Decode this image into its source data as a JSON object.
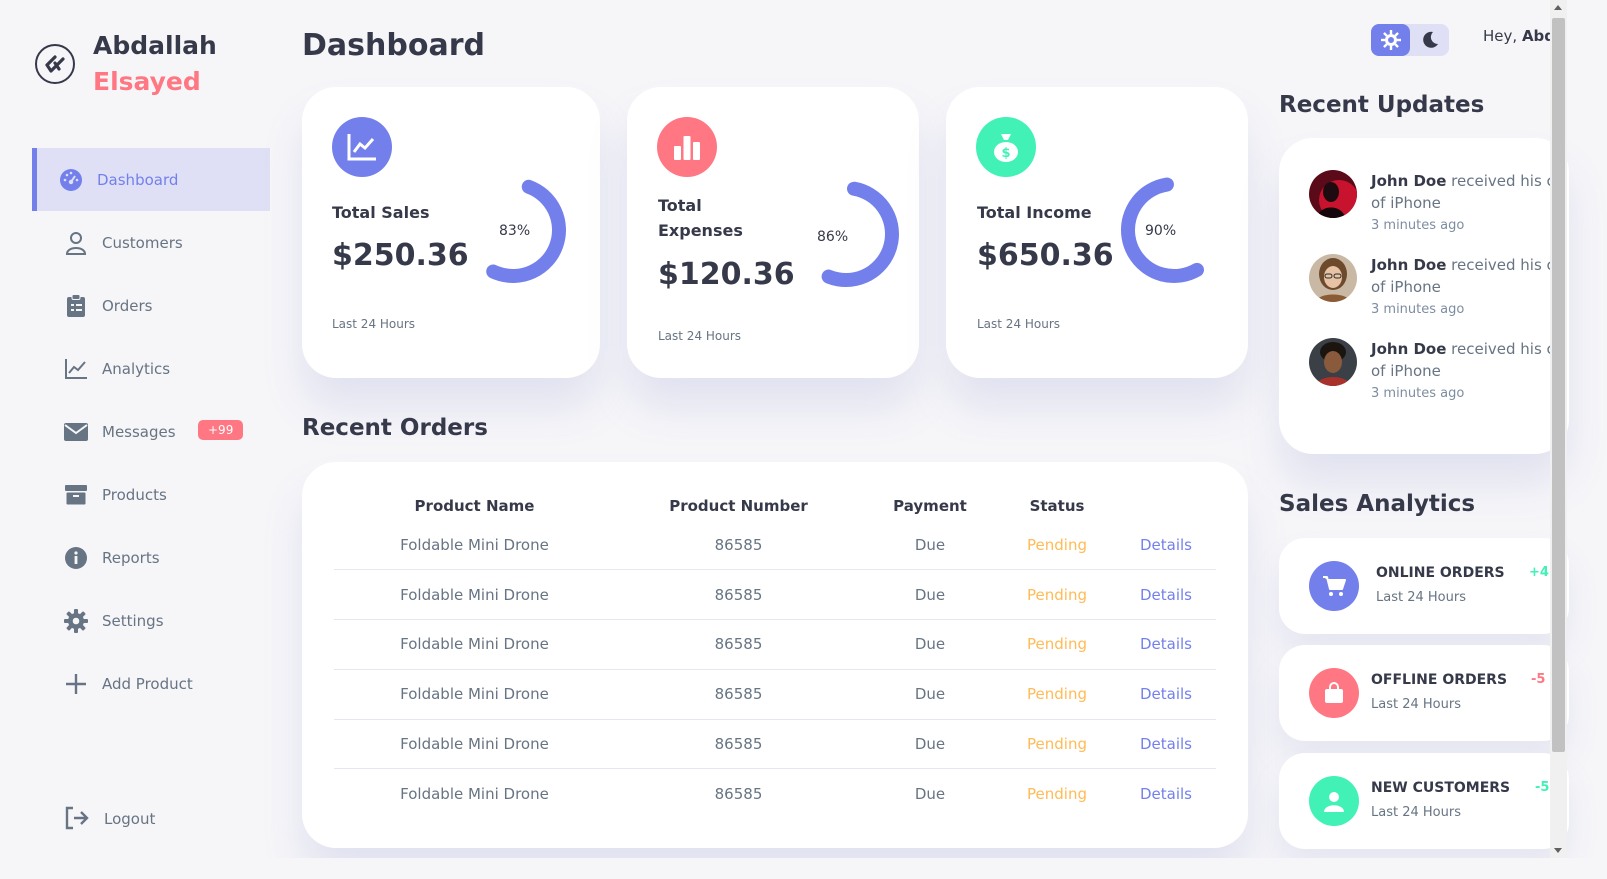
{
  "brand": {
    "first": "Abdallah",
    "last": "Elsayed"
  },
  "sidebar": {
    "items": [
      {
        "label": "Dashboard",
        "icon": "dashboard-icon",
        "active": true
      },
      {
        "label": "Customers",
        "icon": "person-icon"
      },
      {
        "label": "Orders",
        "icon": "clipboard-icon"
      },
      {
        "label": "Analytics",
        "icon": "chart-line-icon"
      },
      {
        "label": "Messages",
        "icon": "mail-icon",
        "badge": "+99"
      },
      {
        "label": "Products",
        "icon": "box-icon"
      },
      {
        "label": "Reports",
        "icon": "info-icon"
      },
      {
        "label": "Settings",
        "icon": "gear-icon"
      },
      {
        "label": "Add Product",
        "icon": "plus-icon"
      }
    ],
    "logout": "Logout"
  },
  "main": {
    "title": "Dashboard",
    "cards": [
      {
        "title": "Total Sales",
        "value": "$250.36",
        "percent": "83%",
        "percent_value": 83,
        "sub": "Last 24 Hours",
        "icon": "chart-line-icon",
        "color": "#7380ec"
      },
      {
        "title": "Total Expenses",
        "value": "$120.36",
        "percent": "86%",
        "percent_value": 86,
        "sub": "Last 24 Hours",
        "icon": "bar-chart-icon",
        "color": "#ff7782"
      },
      {
        "title": "Total Income",
        "value": "$650.36",
        "percent": "90%",
        "percent_value": 90,
        "sub": "Last 24 Hours",
        "icon": "money-bag-icon",
        "color": "#41f1b6"
      }
    ],
    "recent_orders": {
      "title": "Recent Orders",
      "headers": [
        "Product Name",
        "Product Number",
        "Payment",
        "Status"
      ],
      "rows": [
        {
          "name": "Foldable Mini Drone",
          "number": "86585",
          "payment": "Due",
          "status": "Pending",
          "action": "Details"
        },
        {
          "name": "Foldable Mini Drone",
          "number": "86585",
          "payment": "Due",
          "status": "Pending",
          "action": "Details"
        },
        {
          "name": "Foldable Mini Drone",
          "number": "86585",
          "payment": "Due",
          "status": "Pending",
          "action": "Details"
        },
        {
          "name": "Foldable Mini Drone",
          "number": "86585",
          "payment": "Due",
          "status": "Pending",
          "action": "Details"
        },
        {
          "name": "Foldable Mini Drone",
          "number": "86585",
          "payment": "Due",
          "status": "Pending",
          "action": "Details"
        },
        {
          "name": "Foldable Mini Drone",
          "number": "86585",
          "payment": "Due",
          "status": "Pending",
          "action": "Details"
        }
      ]
    }
  },
  "right": {
    "greeting": "Hey,",
    "user": "Abd",
    "recent_updates": {
      "title": "Recent Updates",
      "items": [
        {
          "name": "John Doe",
          "text": " received his c",
          "line2": "of iPhone",
          "time": "3 minutes ago"
        },
        {
          "name": "John Doe",
          "text": " received his c",
          "line2": "of iPhone",
          "time": "3 minutes ago"
        },
        {
          "name": "John Doe",
          "text": " received his c",
          "line2": "of iPhone",
          "time": "3 minutes ago"
        }
      ]
    },
    "sales_analytics": {
      "title": "Sales Analytics",
      "items": [
        {
          "title": "ONLINE ORDERS",
          "sub": "Last 24 Hours",
          "delta": "+4",
          "color": "#7380ec",
          "delta_color": "#41f1b6",
          "icon": "cart-icon"
        },
        {
          "title": "OFFLINE ORDERS",
          "sub": "Last 24 Hours",
          "delta": "-5",
          "color": "#ff7782",
          "delta_color": "#ff7782",
          "icon": "shopping-bag-icon"
        },
        {
          "title": "NEW CUSTOMERS",
          "sub": "Last 24 Hours",
          "delta": "-5",
          "color": "#41f1b6",
          "delta_color": "#41f1b6",
          "icon": "person-icon"
        }
      ]
    }
  }
}
